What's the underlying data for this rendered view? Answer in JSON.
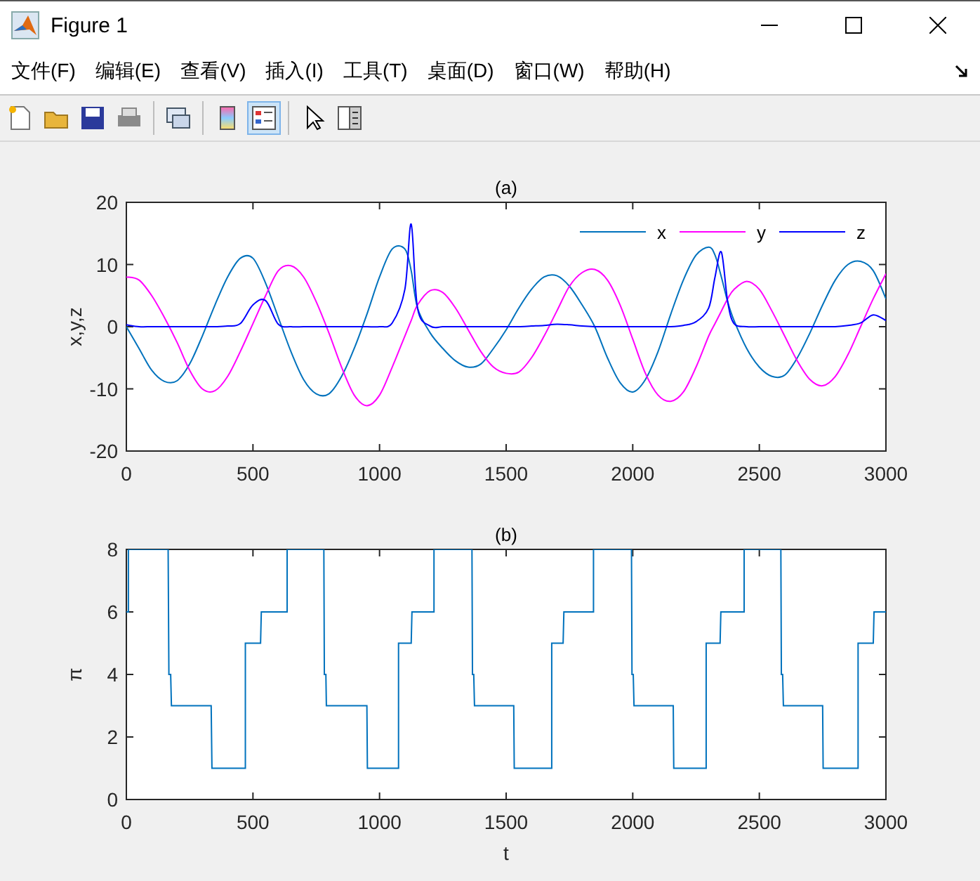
{
  "window": {
    "title": "Figure 1"
  },
  "menu": [
    {
      "label": "文件(F)"
    },
    {
      "label": "编辑(E)"
    },
    {
      "label": "查看(V)"
    },
    {
      "label": "插入(I)"
    },
    {
      "label": "工具(T)"
    },
    {
      "label": "桌面(D)"
    },
    {
      "label": "窗口(W)"
    },
    {
      "label": "帮助(H)"
    }
  ],
  "toolbar": [
    {
      "on": false
    },
    {
      "on": false
    },
    {
      "on": false
    },
    {
      "on": false
    },
    {
      "on": false
    },
    {
      "on": false
    },
    {
      "on": true
    },
    {
      "on": false
    },
    {
      "on": false
    }
  ],
  "plots": [
    {
      "chart_data": {
        "type": "line",
        "title": "(a)",
        "legend": true,
        "ylabel": "x,y,z",
        "xlim": [
          0,
          3000
        ],
        "ylim": [
          -20,
          20
        ],
        "xticks": [
          0,
          500,
          1000,
          1500,
          2000,
          2500,
          3000
        ],
        "yticks": [
          -20,
          -10,
          0,
          10,
          20
        ],
        "x": [
          0,
          50,
          100,
          150,
          200,
          250,
          300,
          350,
          400,
          450,
          500,
          550,
          600,
          650,
          700,
          750,
          800,
          850,
          900,
          950,
          1000,
          1050,
          1100,
          1125,
          1150,
          1200,
          1250,
          1300,
          1350,
          1400,
          1450,
          1500,
          1550,
          1600,
          1650,
          1700,
          1750,
          1800,
          1850,
          1900,
          1950,
          2000,
          2050,
          2100,
          2150,
          2200,
          2250,
          2300,
          2325,
          2350,
          2375,
          2400,
          2450,
          2500,
          2550,
          2600,
          2650,
          2700,
          2750,
          2800,
          2850,
          2900,
          2950,
          3000
        ],
        "series": [
          {
            "name": "x",
            "color": "#0072bd",
            "values": [
              0,
              -3.5,
              -7,
              -8.8,
              -8.7,
              -6,
              -1.5,
              3.5,
              8,
              11,
              11,
              7,
              1.5,
              -4,
              -8.5,
              -10.8,
              -10.8,
              -8,
              -3.5,
              2,
              8,
              12.5,
              12.5,
              9,
              3,
              -1,
              -3.5,
              -5.5,
              -6.5,
              -6,
              -3.5,
              -0.5,
              3,
              6,
              8,
              8.2,
              6.5,
              3.5,
              0,
              -5,
              -9,
              -10.5,
              -8.5,
              -4,
              2,
              7.5,
              11.5,
              12.8,
              11.5,
              8,
              4,
              1,
              -3.5,
              -6.5,
              -8,
              -7.8,
              -5,
              -1,
              3.5,
              7.5,
              10,
              10.5,
              9,
              4.5
            ]
          },
          {
            "name": "y",
            "color": "#ff00ff",
            "values": [
              8,
              7.5,
              5,
              1.5,
              -2.5,
              -7,
              -10,
              -10.3,
              -8,
              -4,
              0.5,
              5,
              9,
              9.8,
              8,
              4,
              -1,
              -6.5,
              -11,
              -12.7,
              -11,
              -6.5,
              -1.5,
              1,
              3.5,
              5.8,
              5.5,
              3,
              -0.5,
              -4,
              -6.5,
              -7.5,
              -7.3,
              -5,
              -1.5,
              2.5,
              6.5,
              8.7,
              9.2,
              7.5,
              3.5,
              -2,
              -7.5,
              -11,
              -12,
              -10.5,
              -6.5,
              -1.5,
              0.5,
              2.5,
              4.5,
              6,
              7.3,
              6,
              2.5,
              -1.5,
              -5.5,
              -8.5,
              -9.5,
              -8,
              -4.5,
              0,
              4.5,
              8.5
            ]
          },
          {
            "name": "z",
            "color": "#0000ff",
            "values": [
              0.3,
              0,
              0,
              0,
              0,
              0,
              0,
              0,
              0.1,
              0.5,
              3.5,
              4.2,
              0.4,
              0,
              0,
              0,
              0,
              0,
              0,
              0,
              0,
              0.6,
              6,
              16.5,
              3,
              0.1,
              0,
              0,
              0,
              0,
              0,
              0,
              0,
              0.1,
              0.2,
              0.4,
              0.3,
              0.1,
              0,
              0,
              0,
              0,
              0,
              0,
              0,
              0.2,
              0.8,
              3,
              8,
              12,
              4,
              0.5,
              0,
              0,
              0,
              0,
              0,
              0,
              0,
              0,
              0.2,
              0.6,
              1.9,
              1
            ]
          }
        ]
      }
    },
    {
      "chart_data": {
        "type": "line",
        "title": "(b)",
        "xlabel": "t",
        "ylabel": "π",
        "xlim": [
          0,
          3000
        ],
        "ylim": [
          0,
          8
        ],
        "xticks": [
          0,
          500,
          1000,
          1500,
          2000,
          2500,
          3000
        ],
        "yticks": [
          0,
          2,
          4,
          6,
          8
        ],
        "x": [
          0,
          8,
          8,
          165,
          168,
          175,
          178,
          335,
          338,
          470,
          470,
          530,
          533,
          635,
          635,
          780,
          782,
          788,
          790,
          950,
          952,
          1075,
          1075,
          1125,
          1128,
          1215,
          1215,
          1365,
          1367,
          1372,
          1375,
          1530,
          1532,
          1680,
          1680,
          1725,
          1728,
          1845,
          1845,
          1995,
          1997,
          2002,
          2005,
          2160,
          2162,
          2290,
          2290,
          2345,
          2348,
          2440,
          2440,
          2585,
          2587,
          2592,
          2595,
          2750,
          2752,
          2890,
          2890,
          2950,
          2953,
          3000
        ],
        "series": [
          {
            "color": "#0072bd",
            "values": [
              6,
              6,
              8,
              8,
              4,
              4,
              3,
              3,
              1,
              1,
              5,
              5,
              6,
              6,
              8,
              8,
              4,
              4,
              3,
              3,
              1,
              1,
              5,
              5,
              6,
              6,
              8,
              8,
              4,
              4,
              3,
              3,
              1,
              1,
              5,
              5,
              6,
              6,
              8,
              8,
              4,
              4,
              3,
              3,
              1,
              1,
              5,
              5,
              6,
              6,
              8,
              8,
              4,
              4,
              3,
              3,
              1,
              1,
              5,
              5,
              6,
              6
            ]
          }
        ]
      }
    }
  ]
}
